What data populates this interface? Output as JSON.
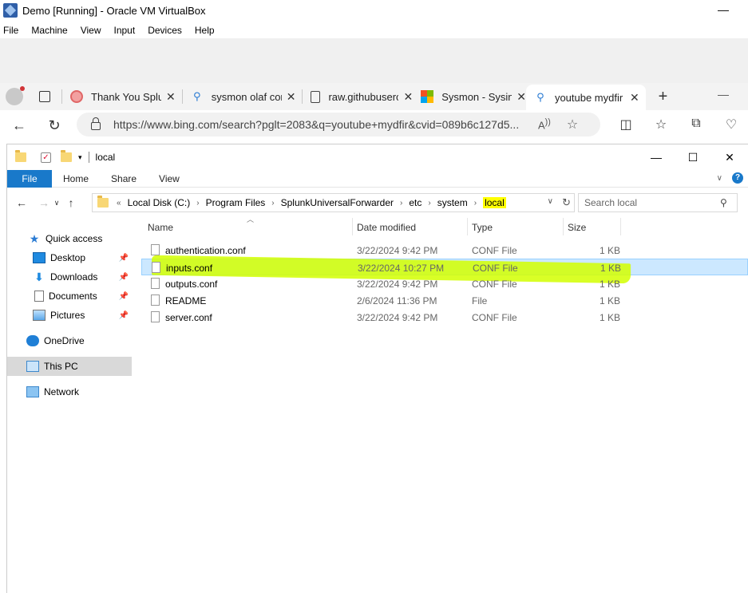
{
  "vbox": {
    "title": "Demo [Running] - Oracle VM VirtualBox",
    "menu": [
      "File",
      "Machine",
      "View",
      "Input",
      "Devices",
      "Help"
    ]
  },
  "browser": {
    "tabs": [
      {
        "label": "Thank You Splunk",
        "icon": "splunk-icon"
      },
      {
        "label": "sysmon olaf config",
        "icon": "bing-search-icon"
      },
      {
        "label": "raw.githubusercontent",
        "icon": "page-icon"
      },
      {
        "label": "Sysmon - Sysinternals",
        "icon": "microsoft-icon"
      },
      {
        "label": "youtube mydfir",
        "icon": "bing-search-icon"
      }
    ],
    "url": "https://www.bing.com/search?pglt=2083&q=youtube+mydfir&cvid=089b6c127d5..."
  },
  "explorer": {
    "title": "local",
    "ribbon": {
      "file": "File",
      "tabs": [
        "Home",
        "Share",
        "View"
      ]
    },
    "breadcrumb": [
      "Local Disk (C:)",
      "Program Files",
      "SplunkUniversalForwarder",
      "etc",
      "system",
      "local"
    ],
    "breadcrumb_prefix": "«",
    "search_placeholder": "Search local",
    "nav": {
      "quick_access": "Quick access",
      "desktop": "Desktop",
      "downloads": "Downloads",
      "documents": "Documents",
      "pictures": "Pictures",
      "onedrive": "OneDrive",
      "this_pc": "This PC",
      "network": "Network"
    },
    "columns": {
      "name": "Name",
      "date": "Date modified",
      "type": "Type",
      "size": "Size"
    },
    "files": [
      {
        "name": "authentication.conf",
        "date": "3/22/2024 9:42 PM",
        "type": "CONF File",
        "size": "1 KB"
      },
      {
        "name": "inputs.conf",
        "date": "3/22/2024 10:27 PM",
        "type": "CONF File",
        "size": "1 KB"
      },
      {
        "name": "outputs.conf",
        "date": "3/22/2024 9:42 PM",
        "type": "CONF File",
        "size": "1 KB"
      },
      {
        "name": "README",
        "date": "2/6/2024 11:36 PM",
        "type": "File",
        "size": "1 KB"
      },
      {
        "name": "server.conf",
        "date": "3/22/2024 9:42 PM",
        "type": "CONF File",
        "size": "1 KB"
      }
    ]
  },
  "colors": {
    "ribbon_file": "#1979ca",
    "selection": "#cce8ff",
    "highlighter": "#d2ff00",
    "crumb_highlight": "#ffff00"
  }
}
